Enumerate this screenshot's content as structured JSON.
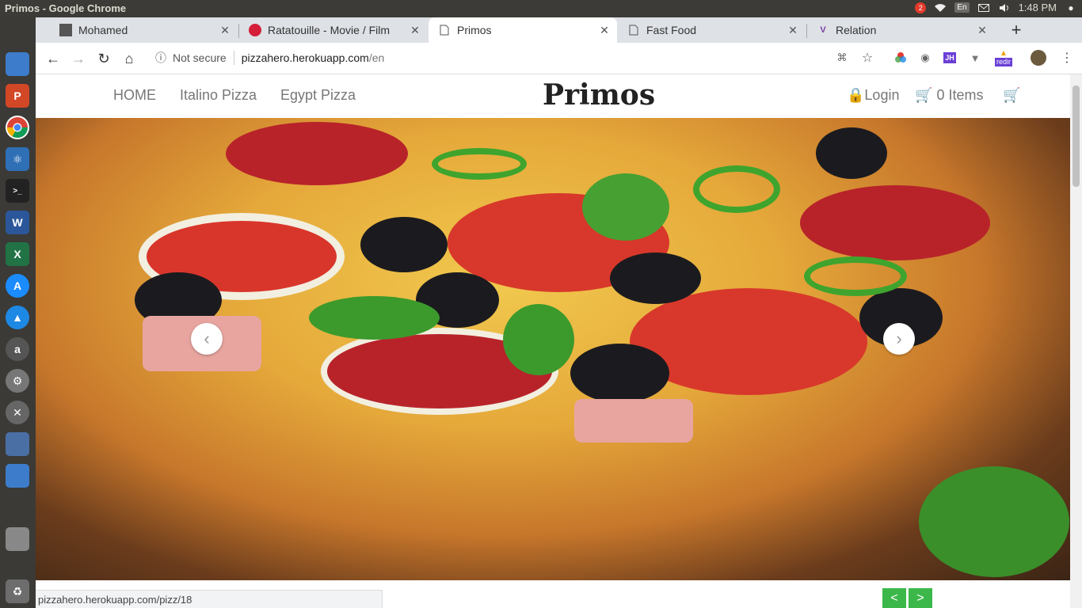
{
  "system": {
    "window_title": "Primos - Google Chrome",
    "notif_count": "2",
    "lang": "En",
    "clock": "1:48 PM"
  },
  "tabs": [
    {
      "label": "Mohamed",
      "icon": "image-favicon-icon"
    },
    {
      "label": "Ratatouille - Movie / Film",
      "icon": "ratatouille-favicon-icon"
    },
    {
      "label": "Primos",
      "icon": "page-icon"
    },
    {
      "label": "Fast Food",
      "icon": "page-icon"
    },
    {
      "label": "Relation",
      "icon": "relation-favicon-icon"
    }
  ],
  "omnibox": {
    "security": "Not secure",
    "host": "pizzahero.herokuapp.com",
    "path": "/en"
  },
  "extensions": {
    "jh": "JH",
    "redir": "redir"
  },
  "site": {
    "nav": {
      "home": "HOME",
      "italino": "Italino Pizza",
      "egypt": "Egypt Pizza"
    },
    "brand": "Primos",
    "login": "Login",
    "cart_items": "0 Items"
  },
  "carousel": {
    "prev": "‹",
    "next": "›"
  },
  "status_url": "pizzahero.herokuapp.com/pizz/18",
  "pager": {
    "prev": "<",
    "next": ">"
  },
  "colors": {
    "accent_green": "#3cb84a",
    "brand_text": "#222222"
  }
}
